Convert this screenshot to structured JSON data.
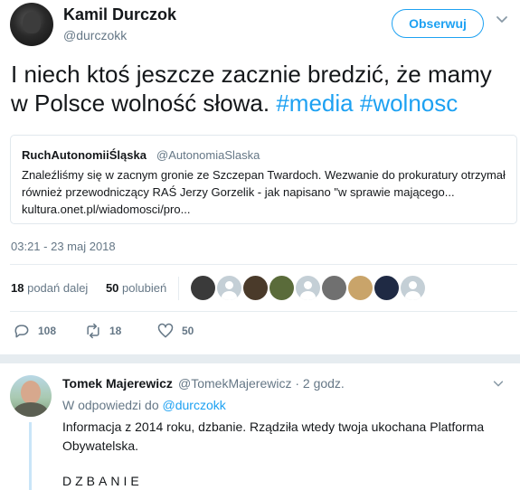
{
  "tweet": {
    "author_name": "Kamil Durczok",
    "author_handle": "@durczokk",
    "follow_label": "Obserwuj",
    "text_plain": "I niech ktoś jeszcze zacznie bredzić, że mamy w Polsce wolność słowa. ",
    "hashtag_1": "#media",
    "hashtag_2": "#wolnosc",
    "timestamp": "03:21 - 23 maj 2018"
  },
  "quoted": {
    "name": "RuchAutonomiiŚląska",
    "handle": "@AutonomiaSlaska",
    "text": "Znaleźliśmy się w zacnym gronie ze Szczepan Twardoch. Wezwanie do prokuratury otrzymał również przewodniczący RAŚ Jerzy Gorzelik - jak napisano \"w sprawie mającego... kultura.onet.pl/wiadomosci/pro..."
  },
  "stats": {
    "retweets_count": "18",
    "retweets_label": "podań dalej",
    "likes_count": "50",
    "likes_label": "polubień"
  },
  "likers": [
    {
      "name": "liker-avatar-1",
      "color": "#3a3a3a"
    },
    {
      "name": "liker-avatar-2",
      "color": "default"
    },
    {
      "name": "liker-avatar-3",
      "color": "#4a3a2a"
    },
    {
      "name": "liker-avatar-4",
      "color": "#5a6b3a"
    },
    {
      "name": "liker-avatar-5",
      "color": "default"
    },
    {
      "name": "liker-avatar-6",
      "color": "#707070"
    },
    {
      "name": "liker-avatar-7",
      "color": "#c9a46a"
    },
    {
      "name": "liker-avatar-8",
      "color": "#1f2a44"
    },
    {
      "name": "liker-avatar-9",
      "color": "default"
    }
  ],
  "actions": {
    "reply_count": "108",
    "retweet_count": "18",
    "like_count": "50"
  },
  "reply": {
    "author_name": "Tomek Majerewicz",
    "meta": "@TomekMajerewicz · 2 godz.",
    "in_reply_prefix": "W odpowiedzi do",
    "in_reply_handle": "@durczokk",
    "text": "Informacja z 2014 roku, dzbanie. Rządziła wtedy twoja ukochana Platforma Obywatelska.",
    "shout": "DZBANIE"
  },
  "colors": {
    "accent": "#1da1f2",
    "muted": "#657786",
    "text": "#14171a",
    "divider": "#e6ecf0"
  }
}
